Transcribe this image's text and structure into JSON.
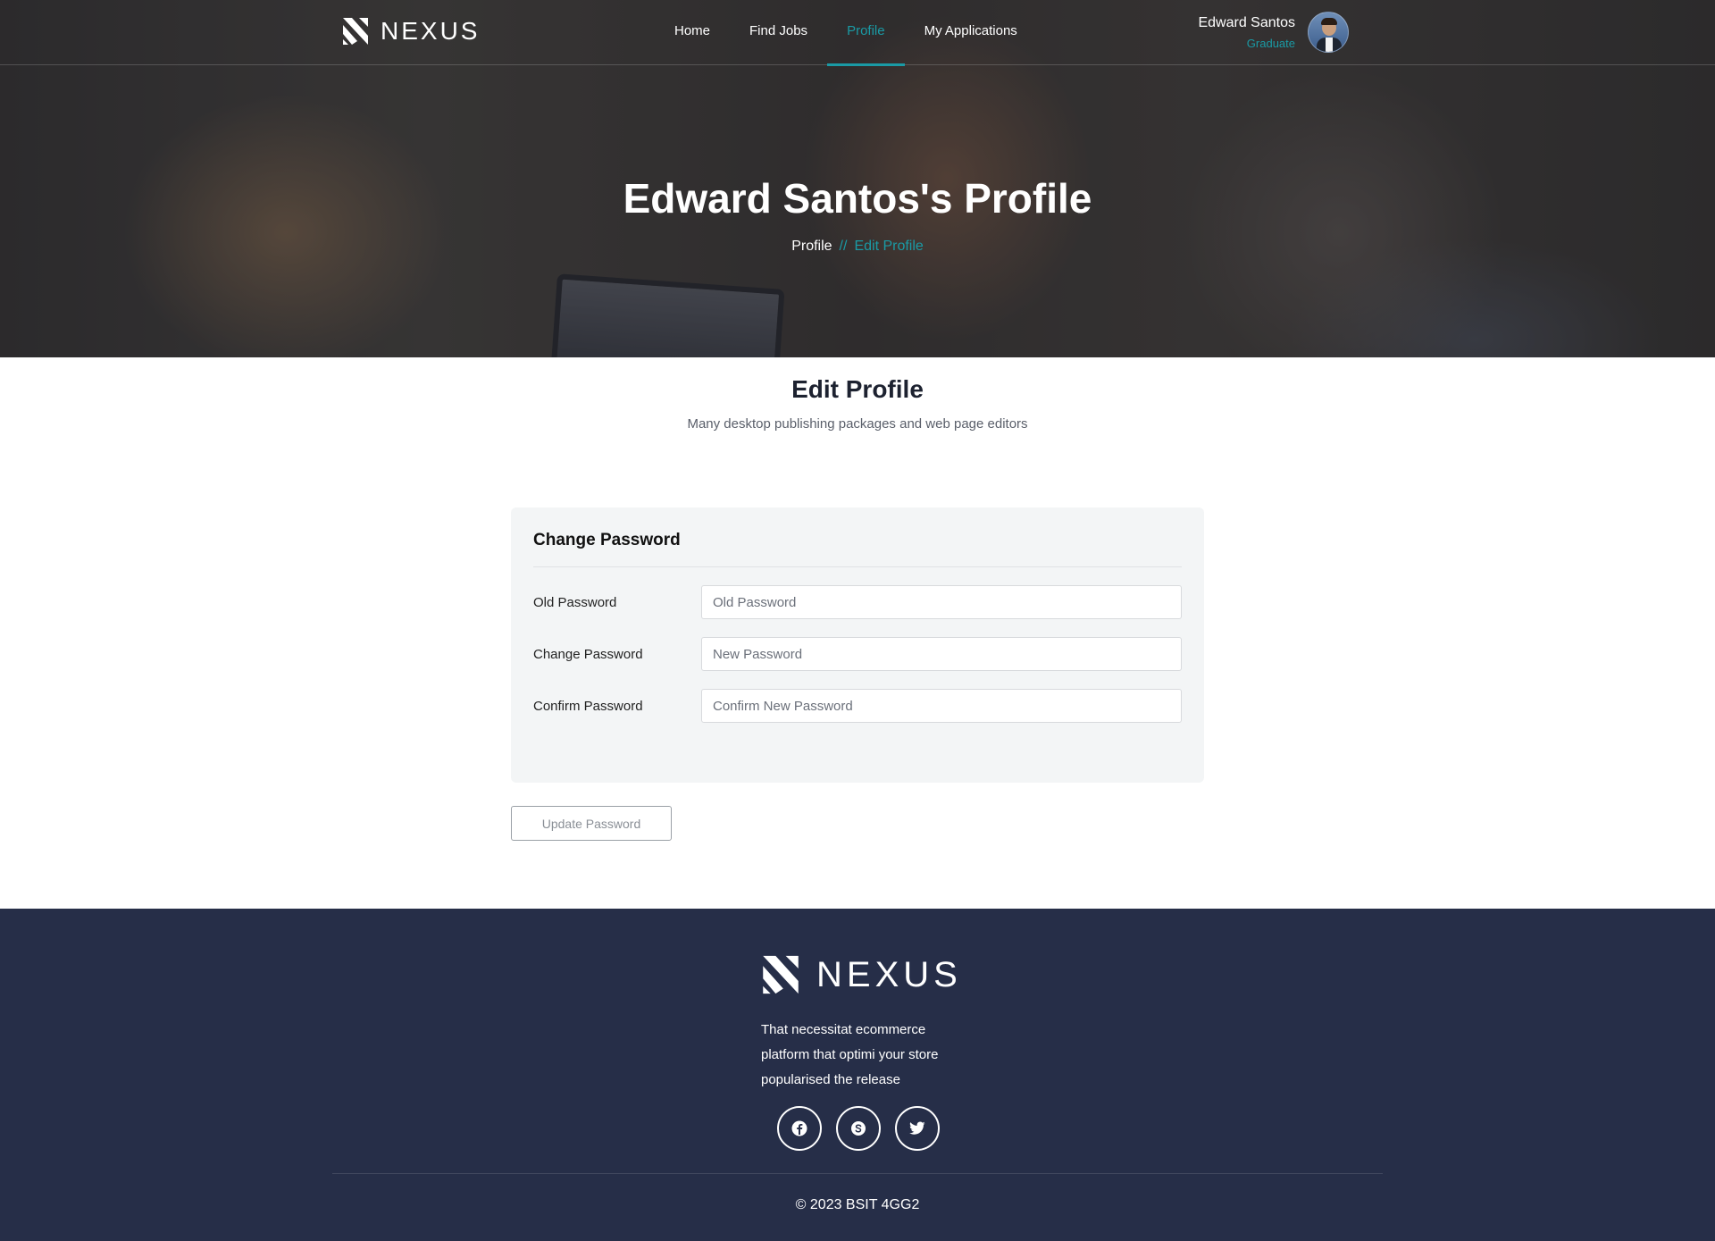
{
  "brand": {
    "name": "NEXUS"
  },
  "nav": {
    "links": [
      {
        "label": "Home"
      },
      {
        "label": "Find Jobs"
      },
      {
        "label": "Profile"
      },
      {
        "label": "My Applications"
      }
    ],
    "active": "Profile"
  },
  "user": {
    "name": "Edward Santos",
    "role": "Graduate"
  },
  "hero": {
    "title": "Edward Santos's Profile",
    "breadcrumb": {
      "home": "Profile",
      "separator": "//",
      "current": "Edit Profile"
    }
  },
  "section": {
    "title": "Edit Profile",
    "subtitle": "Many desktop publishing packages and web page editors"
  },
  "password_form": {
    "title": "Change Password",
    "fields": [
      {
        "label": "Old Password",
        "placeholder": "Old Password",
        "value": ""
      },
      {
        "label": "Change Password",
        "placeholder": "New Password",
        "value": ""
      },
      {
        "label": "Confirm Password",
        "placeholder": "Confirm New Password",
        "value": ""
      }
    ],
    "submit_label": "Update Password"
  },
  "footer": {
    "brand": "NEXUS",
    "description": "That necessitat ecommerce platform that optimi your store popularised the release",
    "socials": [
      "facebook-icon",
      "skype-icon",
      "twitter-icon"
    ],
    "copyright": "© 2023 BSIT 4GG2"
  },
  "colors": {
    "accent": "#1a9aa5",
    "footer_bg": "#262e48",
    "card_bg": "#f3f5f6"
  }
}
